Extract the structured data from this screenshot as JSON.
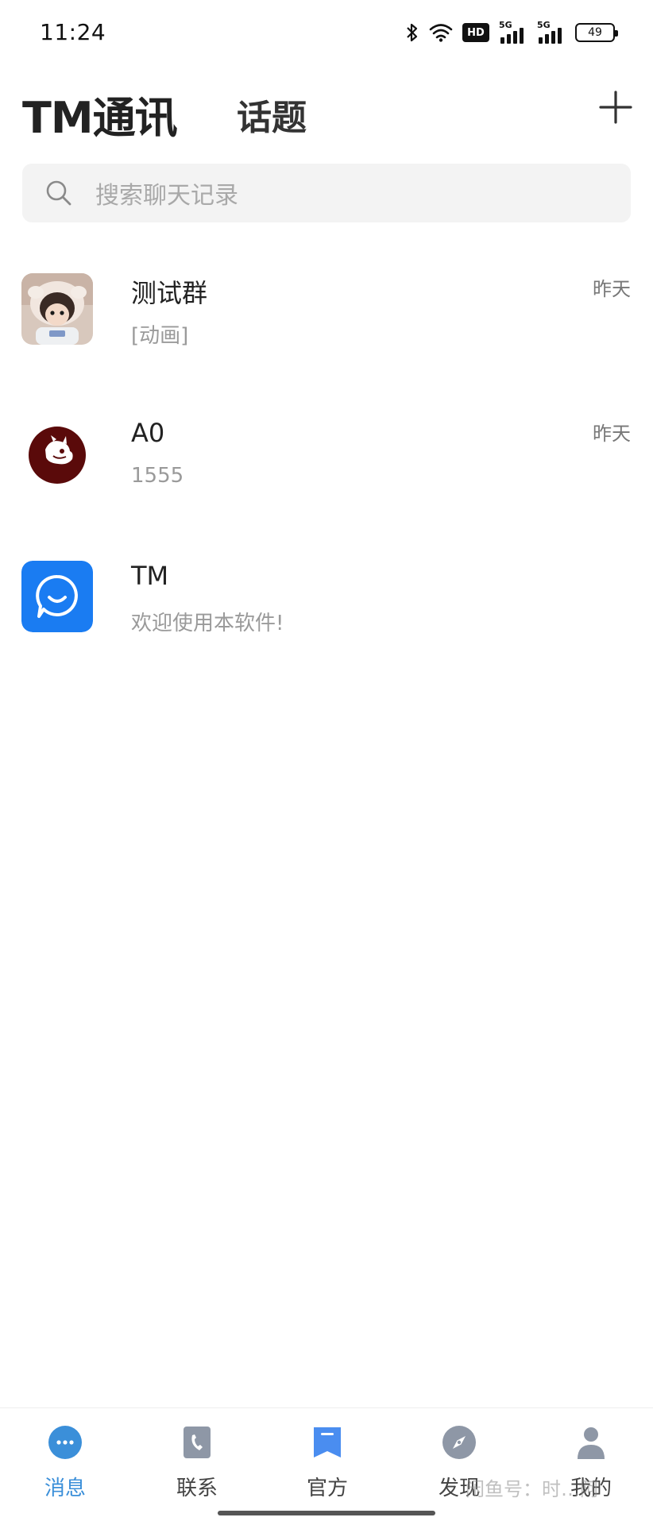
{
  "status_bar": {
    "time": "11:24",
    "hd_label": "HD",
    "network_1": "5G",
    "network_2": "5G",
    "battery_level": "49"
  },
  "header": {
    "app_title": "TM通讯",
    "topics_tab": "话题",
    "add_icon": "plus-icon"
  },
  "search": {
    "placeholder": "搜索聊天记录",
    "icon": "search-icon"
  },
  "chats": [
    {
      "name": "测试群",
      "preview": "[动画]",
      "time": "昨天",
      "avatar": "doll-photo"
    },
    {
      "name": "A0",
      "preview": "1555",
      "time": "昨天",
      "avatar": "dark-red-logo"
    },
    {
      "name": "TM",
      "preview": "欢迎使用本软件!",
      "time": "",
      "avatar": "tm-chat-logo"
    }
  ],
  "nav": [
    {
      "label": "消息",
      "icon": "chat-bubble-icon",
      "active": true
    },
    {
      "label": "联系",
      "icon": "contacts-book-icon",
      "active": false
    },
    {
      "label": "官方",
      "icon": "bookmark-icon",
      "active": false
    },
    {
      "label": "发现",
      "icon": "compass-icon",
      "active": false
    },
    {
      "label": "我的",
      "icon": "person-icon",
      "active": false
    }
  ],
  "watermark": "闲鱼号：时…阿",
  "colors": {
    "accent": "#3b8fd9",
    "tm_logo": "#1a7cf2",
    "a0_logo": "#5a0a0a",
    "search_bg": "#f3f3f3"
  }
}
